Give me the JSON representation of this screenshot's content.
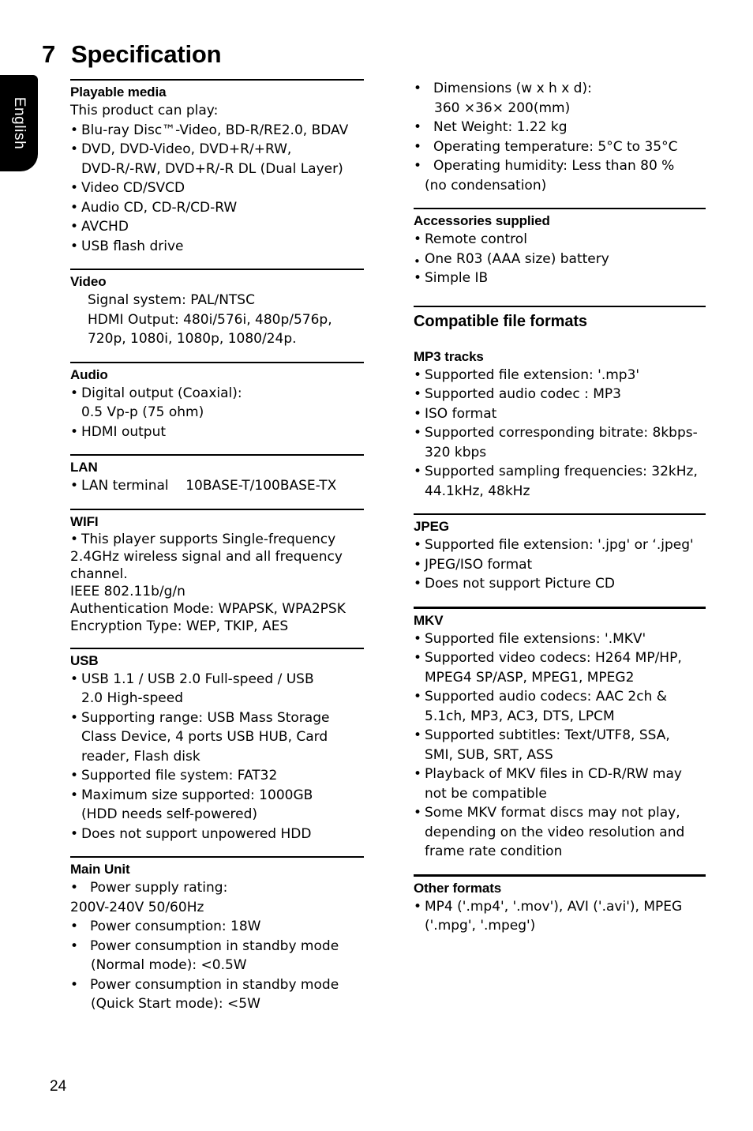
{
  "sidetab": {
    "label": "English"
  },
  "title": {
    "number": "7",
    "text": "Specification"
  },
  "page_number": "24",
  "left_column": {
    "sections": [
      {
        "heading": "Playable media",
        "lines": [
          {
            "type": "plain",
            "text": "This product can play:"
          },
          {
            "type": "bullet",
            "text": "Blu-ray Disc™-Video, BD-R/RE2.0, BDAV"
          },
          {
            "type": "bullet",
            "text": "DVD, DVD-Video, DVD+R/+RW,"
          },
          {
            "type": "cont",
            "text": "DVD-R/-RW, DVD+R/-R DL (Dual Layer)"
          },
          {
            "type": "bullet",
            "text": "Video CD/SVCD"
          },
          {
            "type": "bullet",
            "text": "Audio CD, CD-R/CD-RW"
          },
          {
            "type": "bullet",
            "text": "AVCHD"
          },
          {
            "type": "bullet",
            "text": "USB flash drive"
          }
        ]
      },
      {
        "heading": "Video",
        "lines": [
          {
            "type": "indent",
            "text": "Signal system: PAL/NTSC"
          },
          {
            "type": "indent",
            "text": "HDMI Output: 480i/576i, 480p/576p,"
          },
          {
            "type": "indent",
            "text": "720p, 1080i, 1080p, 1080/24p."
          }
        ]
      },
      {
        "heading": "Audio",
        "lines": [
          {
            "type": "bullet",
            "text": "Digital output (Coaxial):"
          },
          {
            "type": "cont",
            "text": "0.5 Vp-p (75 ohm)"
          },
          {
            "type": "bullet",
            "text": "HDMI output"
          }
        ]
      },
      {
        "heading": "LAN",
        "lines": [
          {
            "type": "bullet",
            "text": "LAN terminal    10BASE-T/100BASE-TX"
          }
        ]
      },
      {
        "heading": "WIFI",
        "lines": [
          {
            "type": "bullet-tight",
            "text": "This player supports Single-frequency"
          },
          {
            "type": "flush-tight",
            "text": "2.4GHz wireless signal and all frequency"
          },
          {
            "type": "flush-tight",
            "text": "channel."
          },
          {
            "type": "flush-tight",
            "text": "IEEE 802.11b/g/n"
          },
          {
            "type": "flush",
            "text": "Authentication Mode: WPAPSK, WPA2PSK"
          },
          {
            "type": "flush",
            "text": "Encryption Type: WEP, TKIP, AES"
          }
        ]
      },
      {
        "heading": "USB",
        "lines": [
          {
            "type": "bullet",
            "text": "USB 1.1 / USB 2.0 Full-speed / USB"
          },
          {
            "type": "cont",
            "text": "2.0 High-speed"
          },
          {
            "type": "bullet",
            "text": "Supporting range: USB Mass Storage"
          },
          {
            "type": "cont",
            "text": "Class Device, 4 ports USB HUB, Card"
          },
          {
            "type": "cont",
            "text": "reader, Flash disk"
          },
          {
            "type": "bullet",
            "text": "Supported file system: FAT32"
          },
          {
            "type": "bullet",
            "text": "Maximum size supported: 1000GB"
          },
          {
            "type": "cont",
            "text": "(HDD needs self-powered)"
          },
          {
            "type": "bullet",
            "text": "Does not support unpowered HDD"
          }
        ]
      },
      {
        "heading": "Main Unit",
        "lines": [
          {
            "type": "bullet-wide",
            "text": "Power supply rating:"
          },
          {
            "type": "cont-flush",
            "text": "200V-240V 50/60Hz"
          },
          {
            "type": "bullet-wide",
            "text": "Power consumption: 18W"
          },
          {
            "type": "bullet-wide",
            "text": "Power consumption in standby mode"
          },
          {
            "type": "cont-wide",
            "text": "(Normal mode): <0.5W"
          },
          {
            "type": "bullet-wide",
            "text": "Power consumption in standby mode"
          },
          {
            "type": "cont-wide",
            "text": "(Quick Start mode): <5W"
          }
        ]
      }
    ]
  },
  "right_column": {
    "continuation_lines": [
      {
        "type": "bullet-wide",
        "text": "Dimensions (w x h x d):"
      },
      {
        "type": "cont-wide",
        "text": "360 ×36× 200(mm)"
      },
      {
        "type": "bullet-wide",
        "text": "Net Weight: 1.22 kg"
      },
      {
        "type": "bullet-wide",
        "text": "Operating temperature: 5°C to 35°C"
      },
      {
        "type": "bullet-wide",
        "text": "Operating humidity: Less than 80 %"
      },
      {
        "type": "cont",
        "text": "(no condensation)"
      }
    ],
    "sections": [
      {
        "heading": "Accessories supplied",
        "lines": [
          {
            "type": "bullet",
            "text": "Remote control"
          },
          {
            "type": "bullet-low",
            "text": "One R03 (AAA size) battery"
          },
          {
            "type": "bullet",
            "text": "Simple IB"
          }
        ]
      }
    ],
    "formats_heading": "Compatible file formats",
    "format_sections": [
      {
        "heading": "MP3 tracks",
        "rule": false,
        "lines": [
          {
            "type": "bullet",
            "text": "Supported file extension: '.mp3'"
          },
          {
            "type": "bullet",
            "text": "Supported audio codec : MP3"
          },
          {
            "type": "bullet",
            "text": "ISO format"
          },
          {
            "type": "bullet",
            "text": "Supported corresponding bitrate: 8kbps-"
          },
          {
            "type": "cont",
            "text": "320 kbps"
          },
          {
            "type": "bullet",
            "text": "Supported sampling frequencies: 32kHz,"
          },
          {
            "type": "cont",
            "text": "44.1kHz, 48kHz"
          }
        ]
      },
      {
        "heading": "JPEG",
        "rule": true,
        "lines": [
          {
            "type": "bullet",
            "text": "Supported file extension: '.jpg' or ‘.jpeg'"
          },
          {
            "type": "bullet",
            "text": "JPEG/ISO format"
          },
          {
            "type": "bullet",
            "text": "Does not support Picture CD"
          }
        ]
      },
      {
        "heading": "MKV",
        "rule": true,
        "thick": true,
        "lines": [
          {
            "type": "bullet",
            "text": "Supported file extensions: '.MKV'"
          },
          {
            "type": "bullet",
            "text": "Supported video codecs: H264 MP/HP,"
          },
          {
            "type": "cont",
            "text": "MPEG4 SP/ASP, MPEG1, MPEG2"
          },
          {
            "type": "bullet",
            "text": "Supported audio codecs: AAC 2ch &"
          },
          {
            "type": "cont",
            "text": "5.1ch, MP3, AC3, DTS, LPCM"
          },
          {
            "type": "bullet",
            "text": "Supported subtitles: Text/UTF8, SSA,"
          },
          {
            "type": "cont",
            "text": "SMI, SUB, SRT, ASS"
          },
          {
            "type": "bullet",
            "text": "Playback of MKV files in CD-R/RW may"
          },
          {
            "type": "cont",
            "text": "not be compatible"
          },
          {
            "type": "bullet",
            "text": "Some MKV format discs may not play,"
          },
          {
            "type": "cont",
            "text": "depending on the video resolution and"
          },
          {
            "type": "cont",
            "text": "frame rate condition"
          }
        ]
      },
      {
        "heading": "Other formats",
        "rule": true,
        "thick": true,
        "lines": [
          {
            "type": "bullet",
            "text": "MP4 ('.mp4', '.mov'), AVI ('.avi'), MPEG"
          },
          {
            "type": "cont",
            "text": "('.mpg', '.mpeg')"
          }
        ]
      }
    ]
  }
}
